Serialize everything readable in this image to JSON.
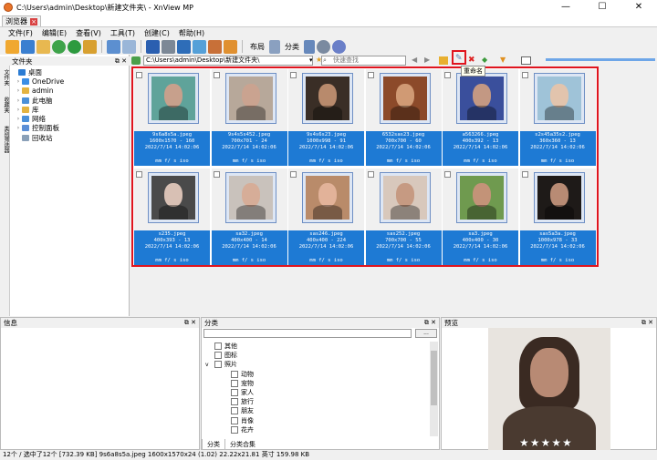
{
  "window": {
    "title": "C:\\Users\\admin\\Desktop\\新建文件夹\\ - XnView MP",
    "min": "—",
    "max": "☐",
    "close": "✕"
  },
  "tab": {
    "label": "浏览器",
    "close": "×"
  },
  "menu": [
    "文件(F)",
    "编辑(E)",
    "查看(V)",
    "工具(T)",
    "创建(C)",
    "帮助(H)"
  ],
  "toolbar": {
    "layout_label": "布局",
    "category_label": "分类"
  },
  "address": {
    "path": "C:\\Users\\admin\\Desktop\\新建文件夹\\",
    "search_placeholder": "快速查找"
  },
  "tooltip": "重命名",
  "left_panel": {
    "title": "文件夹",
    "side_tabs": [
      "文件夹",
      "收藏夹",
      "类别筛选器"
    ],
    "tree": [
      {
        "label": "桌面",
        "expandable": false,
        "color": "#2b7cd3"
      },
      {
        "label": "OneDrive",
        "expandable": true,
        "color": "#3a8ee6"
      },
      {
        "label": "admin",
        "expandable": true,
        "color": "#e3b341"
      },
      {
        "label": "此电脑",
        "expandable": true,
        "color": "#4a90d9"
      },
      {
        "label": "库",
        "expandable": true,
        "color": "#e3b341"
      },
      {
        "label": "网络",
        "expandable": true,
        "color": "#4a90d9"
      },
      {
        "label": "控制面板",
        "expandable": true,
        "color": "#5b8fd6"
      },
      {
        "label": "回收站",
        "expandable": false,
        "color": "#8aa0b8"
      }
    ]
  },
  "thumbnails": [
    {
      "name": "9s6a8s5a.jpeg",
      "dims": "1600x1570 - 160",
      "date": "2022/7/14 14:02:06",
      "exif": "mm f/ s iso",
      "bg": "#5fa39a",
      "face": "#c7a08c"
    },
    {
      "name": "9s4s5s452.jpeg",
      "dims": "700x701 - 24",
      "date": "2022/7/14 14:02:06",
      "exif": "mm f/ s iso",
      "bg": "#b7a89a",
      "face": "#caa390"
    },
    {
      "name": "9s4s6s23.jpeg",
      "dims": "1000x998 - 91",
      "date": "2022/7/14 14:02:06",
      "exif": "mm f/ s iso",
      "bg": "#3a2e26",
      "face": "#b88a6c"
    },
    {
      "name": "6532sas23.jpeg",
      "dims": "700x700 - 60",
      "date": "2022/7/14 14:02:06",
      "exif": "mm f/ s iso",
      "bg": "#8c4a2a",
      "face": "#d09a74"
    },
    {
      "name": "a563266.jpeg",
      "dims": "400x392 - 13",
      "date": "2022/7/14 14:02:06",
      "exif": "mm f/ s iso",
      "bg": "#3a4f9c",
      "face": "#c39883"
    },
    {
      "name": "s2s45a35s2.jpeg",
      "dims": "360x360 - 13",
      "date": "2022/7/14 14:02:06",
      "exif": "mm f/ s iso",
      "bg": "#9fc3d8",
      "face": "#e2c4ad"
    },
    {
      "name": "s235.jpeg",
      "dims": "400x393 - 13",
      "date": "2022/7/14 14:02:06",
      "exif": "mm f/ s iso",
      "bg": "#4a4a4a",
      "face": "#d8c0b4"
    },
    {
      "name": "sa32.jpeg",
      "dims": "400x400 - 14",
      "date": "2022/7/14 14:02:06",
      "exif": "mm f/ s iso",
      "bg": "#c9c2bc",
      "face": "#d6ad98"
    },
    {
      "name": "sas246.jpeg",
      "dims": "400x400 - 224",
      "date": "2022/7/14 14:02:06",
      "exif": "mm f/ s iso",
      "bg": "#b98b6a",
      "face": "#e2b299"
    },
    {
      "name": "sas252.jpeg",
      "dims": "700x700 - 55",
      "date": "2022/7/14 14:02:06",
      "exif": "mm f/ s iso",
      "bg": "#d8c8bc",
      "face": "#c69a82"
    },
    {
      "name": "sa3.jpeg",
      "dims": "400x400 - 30",
      "date": "2022/7/14 14:02:06",
      "exif": "mm f/ s iso",
      "bg": "#6f9a4f",
      "face": "#c39378"
    },
    {
      "name": "sas5a3a.jpeg",
      "dims": "1000x978 - 33",
      "date": "2022/7/14 14:02:06",
      "exif": "mm f/ s iso",
      "bg": "#1e1a18",
      "face": "#b88b74"
    }
  ],
  "info_panel": {
    "title": "信息"
  },
  "category_panel": {
    "title": "分类",
    "items": [
      {
        "label": "其他",
        "indent": 1,
        "expander": ""
      },
      {
        "label": "图标",
        "indent": 1,
        "expander": ""
      },
      {
        "label": "照片",
        "indent": 1,
        "expander": "v"
      },
      {
        "label": "动物",
        "indent": 2,
        "expander": ""
      },
      {
        "label": "宠物",
        "indent": 2,
        "expander": ""
      },
      {
        "label": "家人",
        "indent": 2,
        "expander": ""
      },
      {
        "label": "旅行",
        "indent": 2,
        "expander": ""
      },
      {
        "label": "朋友",
        "indent": 2,
        "expander": ""
      },
      {
        "label": "肖像",
        "indent": 2,
        "expander": ""
      },
      {
        "label": "花卉",
        "indent": 2,
        "expander": ""
      }
    ],
    "tabs": [
      "分类",
      "分类合集"
    ],
    "dropdown": "..."
  },
  "preview_panel": {
    "title": "预览",
    "stars": "★★★★★",
    "bg": "#e8e4df",
    "face": "#b88a74"
  },
  "status": "12个 / 选中了12个 [732.39 KB]   9s6a8s5a.jpeg   1600x1570x24 (1.02)   22.22x21.81 英寸   159.98 KB"
}
